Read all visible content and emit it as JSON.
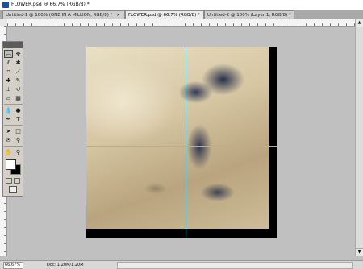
{
  "window": {
    "title": "FLOWER.psd @ 66.7% (RGB/8) *"
  },
  "tabs": [
    {
      "label": "Untitled-1 @ 100% (ONE IN A MILLION, RGB/8) *",
      "close": "×",
      "active": false
    },
    {
      "label": "FLOWER.psd @ 66.7% (RGB/8) *",
      "close": "×",
      "active": true
    },
    {
      "label": "Untitled-2 @ 100% (Layer 1, RGB/8) *",
      "close": "×",
      "active": false
    }
  ],
  "status": {
    "zoom": "66.67%",
    "doc": "Doc: 1.20M/1.20M"
  },
  "toolbox": {
    "tools": [
      [
        "marquee-tool",
        "▭"
      ],
      [
        "move-tool",
        "✥"
      ],
      [
        "lasso-tool",
        "ℓ"
      ],
      [
        "magic-wand-tool",
        "✱"
      ],
      [
        "crop-tool",
        "⌗"
      ],
      [
        "slice-tool",
        "⟋"
      ],
      [
        "healing-brush-tool",
        "✚"
      ],
      [
        "brush-tool",
        "✎"
      ],
      [
        "clone-stamp-tool",
        "⊥"
      ],
      [
        "history-brush-tool",
        "↺"
      ],
      [
        "eraser-tool",
        "▱"
      ],
      [
        "gradient-tool",
        "▦"
      ],
      [
        "blur-tool",
        "💧"
      ],
      [
        "dodge-tool",
        "●"
      ],
      [
        "pen-tool",
        "✒"
      ],
      [
        "type-tool",
        "T"
      ],
      [
        "path-selection-tool",
        "➤"
      ],
      [
        "shape-tool",
        "□"
      ],
      [
        "notes-tool",
        "✉"
      ],
      [
        "eyedropper-tool",
        "⚲"
      ],
      [
        "hand-tool",
        "✋"
      ],
      [
        "zoom-tool",
        "⚲"
      ]
    ],
    "swatch_reset": "⬛"
  },
  "colors": {
    "foreground": "#ffffff",
    "background": "#000000",
    "guide": "#6cc7d4"
  }
}
